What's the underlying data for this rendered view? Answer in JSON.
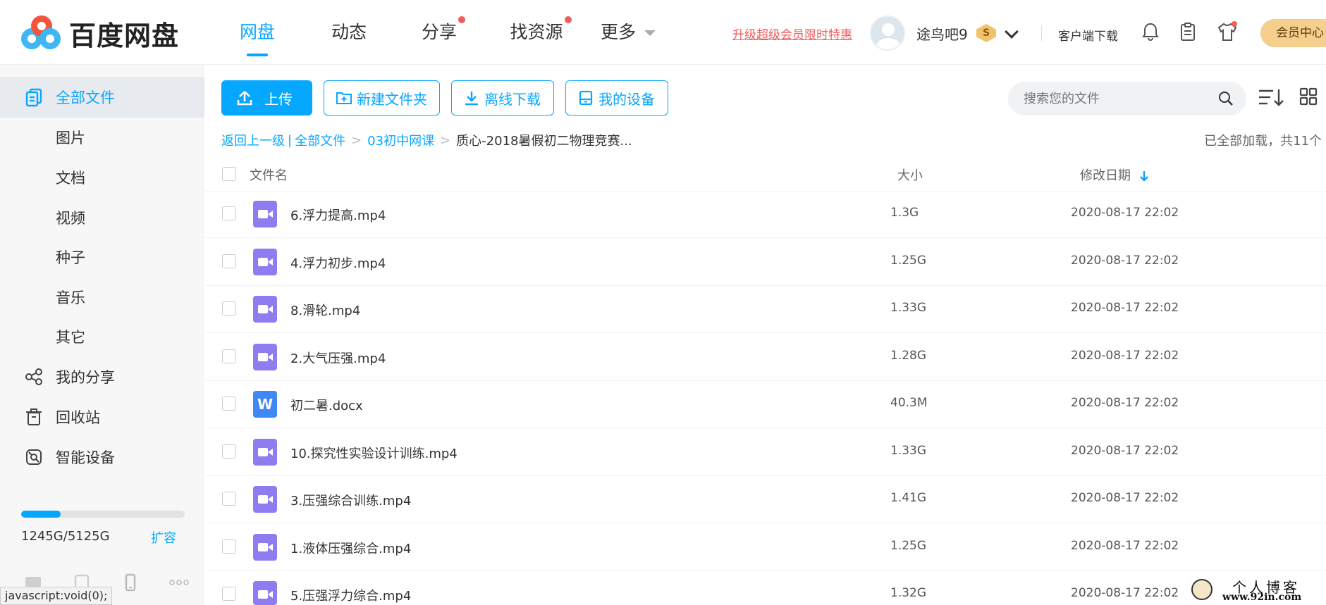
{
  "brand": {
    "name": "百度网盘"
  },
  "nav": {
    "items": [
      {
        "label": "网盘",
        "active": true,
        "dot": false
      },
      {
        "label": "动态",
        "active": false,
        "dot": false
      },
      {
        "label": "分享",
        "active": false,
        "dot": true
      },
      {
        "label": "找资源",
        "active": false,
        "dot": true
      },
      {
        "label": "更多",
        "active": false,
        "dot": false,
        "caret": true
      }
    ]
  },
  "header": {
    "promo": "升级超级会员限时特惠",
    "username": "途鸟吧9",
    "vip_letter": "S",
    "client_download": "客户端下载",
    "vip_center": "会员中心"
  },
  "sidebar": {
    "items": [
      {
        "label": "全部文件",
        "active": true,
        "icon": "all-files-icon"
      },
      {
        "label": "图片",
        "sub": true
      },
      {
        "label": "文档",
        "sub": true
      },
      {
        "label": "视频",
        "sub": true
      },
      {
        "label": "种子",
        "sub": true
      },
      {
        "label": "音乐",
        "sub": true
      },
      {
        "label": "其它",
        "sub": true
      },
      {
        "label": "我的分享",
        "icon": "share-icon"
      },
      {
        "label": "回收站",
        "icon": "trash-icon"
      },
      {
        "label": "智能设备",
        "icon": "device-icon"
      }
    ],
    "storage": {
      "text": "1245G/5125G",
      "used_fraction": 0.243,
      "expand_label": "扩容"
    },
    "status_tip": "javascript:void(0);"
  },
  "toolbar": {
    "upload": "上传",
    "new_folder": "新建文件夹",
    "offline_download": "离线下载",
    "my_device": "我的设备",
    "search_placeholder": "搜索您的文件"
  },
  "breadcrumb": {
    "back": "返回上一级",
    "all_files": "全部文件",
    "level1": "03初中网课",
    "current": "质心-2018暑假初二物理竞赛..."
  },
  "load_info": "已全部加载，共11个",
  "table": {
    "headers": {
      "name": "文件名",
      "size": "大小",
      "date": "修改日期"
    },
    "rows": [
      {
        "name": "6.浮力提高.mp4",
        "size": "1.3G",
        "date": "2020-08-17 22:02",
        "type": "video"
      },
      {
        "name": "4.浮力初步.mp4",
        "size": "1.25G",
        "date": "2020-08-17 22:02",
        "type": "video"
      },
      {
        "name": "8.滑轮.mp4",
        "size": "1.33G",
        "date": "2020-08-17 22:02",
        "type": "video"
      },
      {
        "name": "2.大气压强.mp4",
        "size": "1.28G",
        "date": "2020-08-17 22:02",
        "type": "video"
      },
      {
        "name": "初二暑.docx",
        "size": "40.3M",
        "date": "2020-08-17 22:02",
        "type": "doc"
      },
      {
        "name": "10.探究性实验设计训练.mp4",
        "size": "1.33G",
        "date": "2020-08-17 22:02",
        "type": "video"
      },
      {
        "name": "3.压强综合训练.mp4",
        "size": "1.41G",
        "date": "2020-08-17 22:02",
        "type": "video"
      },
      {
        "name": "1.液体压强综合.mp4",
        "size": "1.25G",
        "date": "2020-08-17 22:02",
        "type": "video"
      },
      {
        "name": "5.压强浮力综合.mp4",
        "size": "1.32G",
        "date": "2020-08-17 22:02",
        "type": "video"
      }
    ]
  },
  "watermark": {
    "title": "个人博客",
    "url": "www.92in.com"
  },
  "colors": {
    "accent": "#06a7ff",
    "promo": "#f25c5c",
    "video_icon": "#8e7cf0",
    "doc_icon": "#3f88f5"
  }
}
